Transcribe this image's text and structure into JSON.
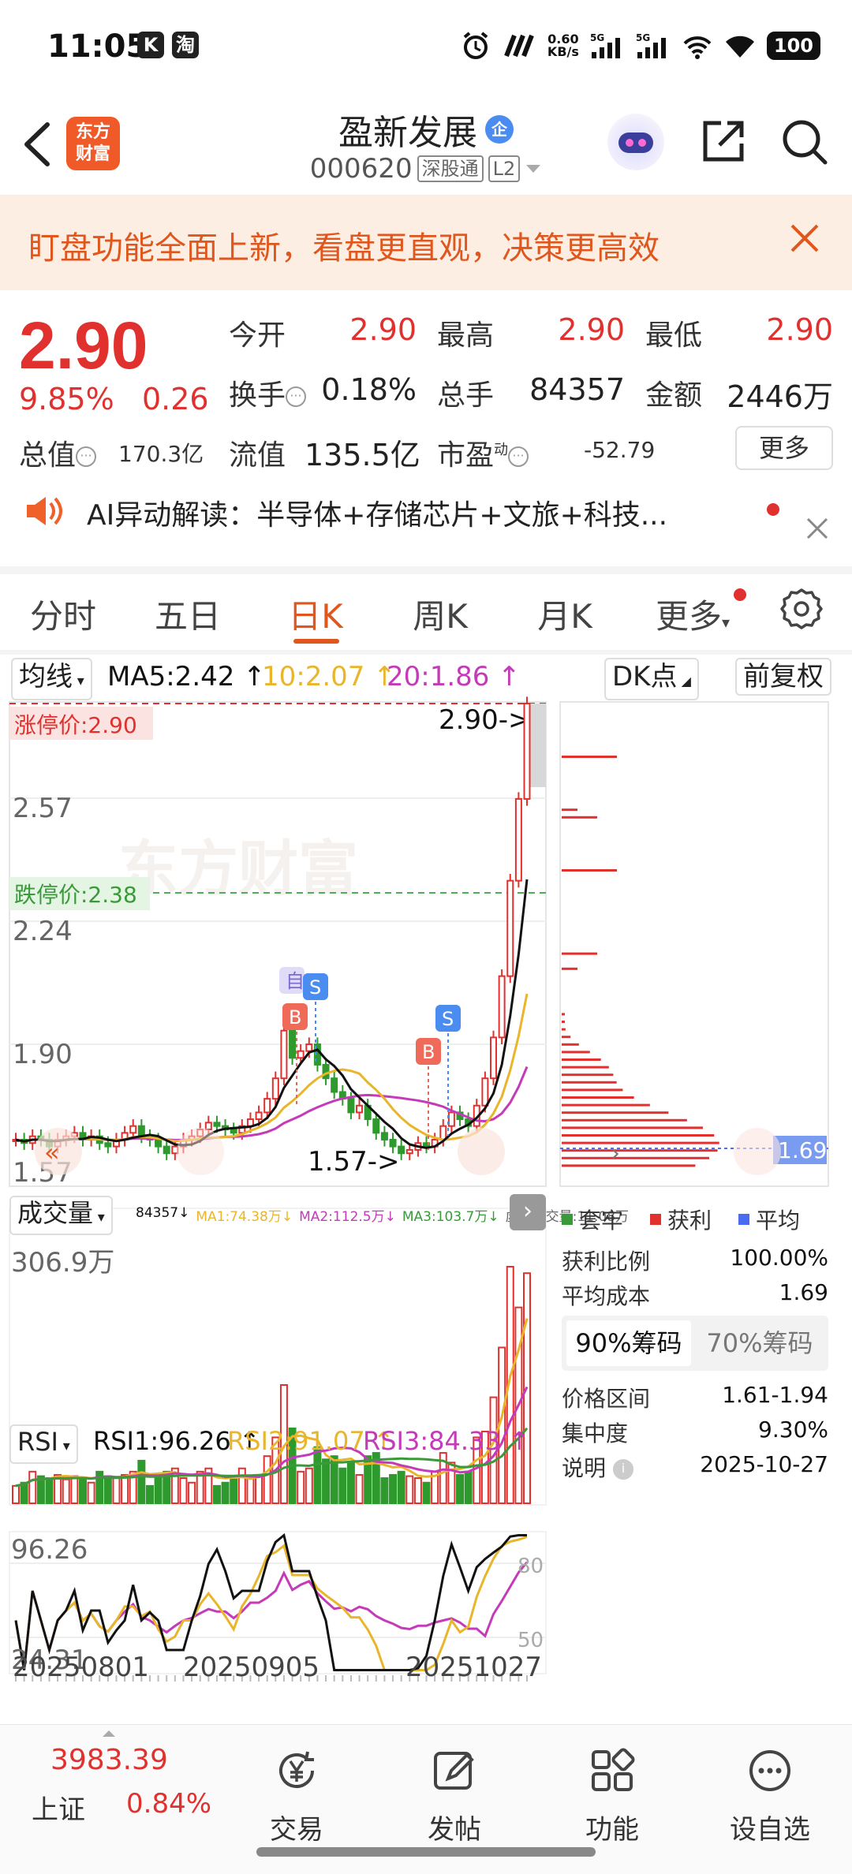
{
  "status_bar": {
    "time": "11:05",
    "badge1": "K",
    "badge2": "淘",
    "net_speed": "0.60",
    "net_unit": "KB/s",
    "battery": "100"
  },
  "header": {
    "logo_line1": "东方",
    "logo_line2": "财富",
    "stock_name": "盈新发展",
    "stock_badge": "企",
    "stock_code": "000620",
    "market_tag": "深股通",
    "level_tag": "L2"
  },
  "banner": {
    "text": "盯盘功能全面上新，看盘更直观，决策更高效"
  },
  "quote": {
    "price": "2.90",
    "change_pct": "9.85%",
    "change_val": "0.26",
    "open_label": "今开",
    "open": "2.90",
    "high_label": "最高",
    "high": "2.90",
    "low_label": "最低",
    "low": "2.90",
    "turnover_label": "换手",
    "turnover": "0.18%",
    "volume_label": "总手",
    "volume": "84357",
    "amount_label": "金额",
    "amount": "2446万",
    "mktcap_label": "总值",
    "mktcap": "170.3亿",
    "float_label": "流值",
    "float": "135.5亿",
    "pe_label": "市盈",
    "pe_sup": "动",
    "pe": "-52.79",
    "more_label": "更多"
  },
  "ai_strip": {
    "text": "AI异动解读：半导体+存储芯片+文旅+科技..."
  },
  "tabs": [
    "分时",
    "五日",
    "日K",
    "周K",
    "月K",
    "更多"
  ],
  "active_tab": 2,
  "chart_toolbar": {
    "ma_selector": "均线",
    "ma5": "MA5:2.42 ↑",
    "ma10": "10:2.07 ↑",
    "ma20": "20:1.86 ↑",
    "dk_button": "DK点",
    "adjust_button": "前复权"
  },
  "kline": {
    "limit_up_label": "涨停价:2.90",
    "limit_down_label": "跌停价:2.38",
    "price_ticks": [
      "2.57",
      "2.24",
      "1.90",
      "1.57"
    ],
    "top_price_partial": "2.90",
    "last_marker": "2.90->",
    "low_marker": "1.57->",
    "watermark": "东方财富",
    "signals": [
      "自",
      "S",
      "B",
      "B",
      "S"
    ],
    "chip_avg_tag": "1.69"
  },
  "volume_panel": {
    "selector": "成交量",
    "stats": "84357↓",
    "ma1": "MA1:74.38万↓",
    "ma2": "MA2:112.5万↓",
    "ma3": "MA3:103.7万↓",
    "virtual": "虚拟成交量:11.08万",
    "max_label": "306.9万"
  },
  "rsi_panel": {
    "selector": "RSI",
    "rsi1": "RSI1:96.26 ↑",
    "rsi2": "RSI2:91.07 ↑",
    "rsi3": "RSI3:84.33 ↑",
    "top_label": "96.26",
    "bottom_label": "24.31",
    "level80": "80",
    "level50": "50"
  },
  "x_axis": [
    "20250801",
    "20250905",
    "20251027"
  ],
  "chip_panel": {
    "legend": [
      "套牢",
      "获利",
      "平均"
    ],
    "profit_ratio_label": "获利比例",
    "profit_ratio": "100.00%",
    "avg_cost_label": "平均成本",
    "avg_cost": "1.69",
    "tab_a": "90%筹码",
    "tab_b": "70%筹码",
    "range_label": "价格区间",
    "range": "1.61-1.94",
    "concentration_label": "集中度",
    "concentration": "9.30%",
    "note_label": "说明",
    "note_date": "2025-10-27"
  },
  "bottom_nav": {
    "index_value": "3983.39",
    "index_name": "上证",
    "index_change": "0.84%",
    "items": [
      "交易",
      "发帖",
      "功能",
      "设自选"
    ]
  },
  "colors": {
    "up": "#e0312e",
    "down": "#2e9a2e",
    "ma5": "#111111",
    "ma10": "#e8b52b",
    "ma20": "#c43ab8",
    "accent": "#e0571e"
  }
}
